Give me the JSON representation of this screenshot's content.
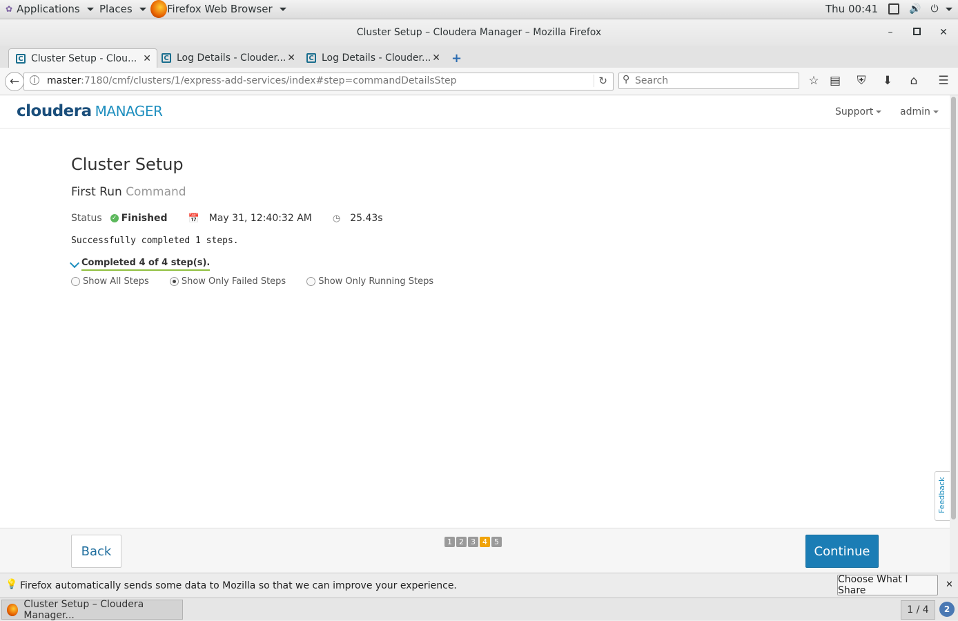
{
  "topbar": {
    "applications": "Applications",
    "places": "Places",
    "browser": "Firefox Web Browser",
    "clock": "Thu 00:41"
  },
  "window": {
    "title": "Cluster Setup – Cloudera Manager – Mozilla Firefox"
  },
  "tabs": [
    {
      "label": "Cluster Setup - Clou..."
    },
    {
      "label": "Log Details - Clouder..."
    },
    {
      "label": "Log Details - Clouder..."
    }
  ],
  "nav": {
    "url_host": "master",
    "url_rest": ":7180/cmf/clusters/1/express-add-services/index#step=commandDetailsStep",
    "search_placeholder": "Search"
  },
  "cm": {
    "logo_main": "cloudera",
    "logo_sub": "MANAGER",
    "support": "Support",
    "user": "admin",
    "page_title": "Cluster Setup",
    "subtitle_main": "First Run",
    "subtitle_sub": "Command",
    "status_label": "Status",
    "status_value": "Finished",
    "date": "May 31, 12:40:32 AM",
    "duration": "25.43s",
    "message": "Successfully completed 1 steps.",
    "completed": "Completed 4 of 4 step(s).",
    "filters": [
      {
        "label": "Show All Steps",
        "selected": false
      },
      {
        "label": "Show Only Failed Steps",
        "selected": true
      },
      {
        "label": "Show Only Running Steps",
        "selected": false
      }
    ],
    "feedback": "Feedback",
    "back": "Back",
    "continue": "Continue",
    "steps": [
      "1",
      "2",
      "3",
      "4",
      "5"
    ],
    "current_step": 4,
    "accent": "#1b7db5",
    "step_accent": "#f0a30a"
  },
  "notification": {
    "text": "Firefox automatically sends some data to Mozilla so that we can improve your experience.",
    "button": "Choose What I Share"
  },
  "taskbar": {
    "item": "Cluster Setup – Cloudera Manager...",
    "workspace": "1 / 4",
    "badge": "2"
  }
}
